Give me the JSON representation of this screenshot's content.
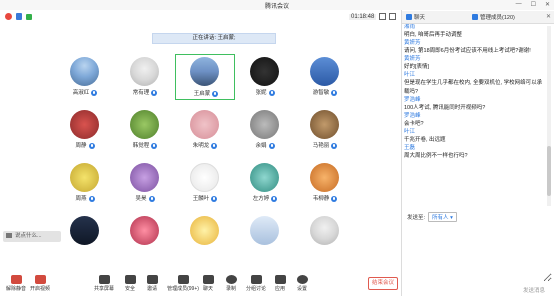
{
  "window": {
    "title": "腾讯会议",
    "timer": "01:18:48"
  },
  "speaking": "正在讲话: 王启蒙;",
  "participants": [
    {
      "name": "高淑红",
      "avatar": "a-sky"
    },
    {
      "name": "常有理",
      "avatar": "a-man"
    },
    {
      "name": "王启蒙",
      "avatar": "a-lake",
      "active": true
    },
    {
      "name": "张妮",
      "avatar": "a-dark"
    },
    {
      "name": "游智敏",
      "avatar": "a-blue"
    },
    {
      "name": "周静",
      "avatar": "a-red"
    },
    {
      "name": "韩觉程",
      "avatar": "a-green"
    },
    {
      "name": "朱明龙",
      "avatar": "a-pink"
    },
    {
      "name": "余娟",
      "avatar": "a-gray"
    },
    {
      "name": "马艳丽",
      "avatar": "a-brown"
    },
    {
      "name": "周燕",
      "avatar": "a-yellow"
    },
    {
      "name": "吴昊",
      "avatar": "a-purple"
    },
    {
      "name": "王麟叶",
      "avatar": "a-white"
    },
    {
      "name": "左方婷",
      "avatar": "a-teal"
    },
    {
      "name": "韦柳静",
      "avatar": "a-orange"
    },
    {
      "name": "",
      "avatar": "a-night"
    },
    {
      "name": "",
      "avatar": "a-rose"
    },
    {
      "name": "",
      "avatar": "a-sun"
    },
    {
      "name": "",
      "avatar": "a-cloud"
    },
    {
      "name": "",
      "avatar": "a-man"
    }
  ],
  "say_something": "说点什么...",
  "toolbar": {
    "unmute": "解除静音",
    "start_video": "开启视频",
    "share_screen": "共享屏幕",
    "security": "安全",
    "invite": "邀请",
    "members": "管理成员(99+)",
    "chat": "聊天",
    "record": "录制",
    "breakout": "分组讨论",
    "apps": "应用",
    "settings": "设置",
    "end_meeting": "结束会议"
  },
  "panel": {
    "chat_tab": "聊天",
    "members_tab": "管理成员(120)"
  },
  "messages": [
    {
      "name": "湘雨",
      "text": "明白, 咱哥后再手动调整"
    },
    {
      "name": "黄妍芳",
      "text": "请问, 第18周即6月份考试应该不用线上考试吧?谢谢!"
    },
    {
      "name": "黄妍芳",
      "text": "好的[表情]"
    },
    {
      "name": "叶江",
      "text": "但是现在学生几乎都在校内, 全要双机位, 学校网络可以承载吗?"
    },
    {
      "name": "罗浩峰",
      "text": "100人考试, 腾讯能同时开视频吗?"
    },
    {
      "name": "罗浩峰",
      "text": "会卡吧?"
    },
    {
      "name": "叶江",
      "text": "千兆开卷, 出远题"
    },
    {
      "name": "王磊",
      "text": "周大周比例不一样也行吗?"
    }
  ],
  "send_to_label": "发送至:",
  "send_to_value": "所有人",
  "send_button": "发送消息"
}
